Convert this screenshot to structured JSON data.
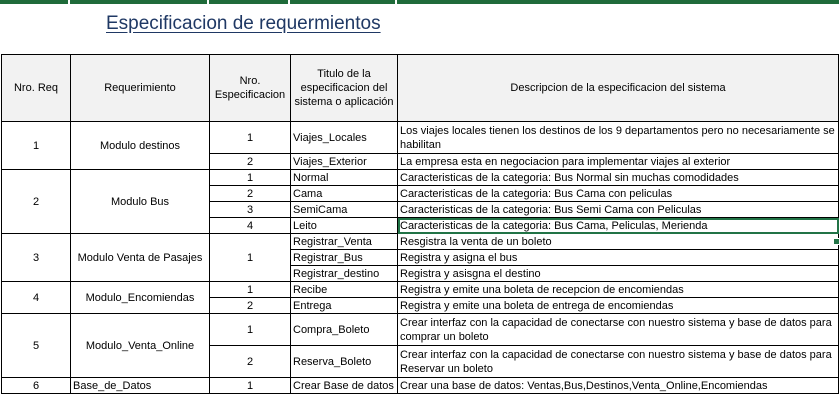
{
  "title": "Especificacion de requermientos",
  "headers": {
    "nro_req": "Nro. Req",
    "requerimiento": "Requerimiento",
    "nro_espec": "Nro. Especificacion",
    "titulo": "Titulo de la especificacion del sistema o aplicación",
    "descripcion": "Descripcion de la especificacion del sistema"
  },
  "requirements": [
    {
      "nro": "1",
      "name": "Modulo destinos",
      "specs": [
        {
          "n": "1",
          "title": "Viajes_Locales",
          "desc": "Los viajes locales tienen los destinos de los 9 departamentos pero no necesariamente se habilitan"
        },
        {
          "n": "2",
          "title": "Viajes_Exterior",
          "desc": "La empresa esta en negociacion para implementar viajes al exterior"
        }
      ]
    },
    {
      "nro": "2",
      "name": "Modulo Bus",
      "specs": [
        {
          "n": "1",
          "title": "Normal",
          "desc": "Caracteristicas de la categoria: Bus Normal sin muchas comodidades"
        },
        {
          "n": "2",
          "title": "Cama",
          "desc": "Caracteristicas de la categoria:  Bus Cama con peliculas"
        },
        {
          "n": "3",
          "title": "SemiCama",
          "desc": "Caracteristicas de la categoria:  Bus Semi Cama con Peliculas"
        },
        {
          "n": "4",
          "title": "Leito",
          "desc": "Caracteristicas de la categoria:  Bus Cama, Peliculas, Merienda"
        }
      ]
    },
    {
      "nro": "3",
      "name": "Modulo Venta de Pasajes",
      "spec_number": "1",
      "titles": [
        {
          "title": "Registrar_Venta",
          "desc": "Resgistra la venta de un boleto"
        },
        {
          "title": "Registrar_Bus",
          "desc": "Registra y asigna el bus"
        },
        {
          "title": "Registrar_destino",
          "desc": "Registra y asisgna el destino"
        }
      ]
    },
    {
      "nro": "4",
      "name": "Modulo_Encomiendas",
      "specs": [
        {
          "n": "1",
          "title": "Recibe",
          "desc": "Registra y emite una boleta de recepcion de encomiendas"
        },
        {
          "n": "2",
          "title": "Entrega",
          "desc": "Registra y emite una boleta de entrega de encomiendas"
        }
      ]
    },
    {
      "nro": "5",
      "name": "Modulo_Venta_Online",
      "specs": [
        {
          "n": "1",
          "title": "Compra_Boleto",
          "desc": "Crear interfaz con la capacidad de conectarse con nuestro sistema y base de datos para comprar un boleto"
        },
        {
          "n": "2",
          "title": "Reserva_Boleto",
          "desc": "Crear interfaz con la capacidad de conectarse con nuestro sistema y base de datos para Reservar un boleto"
        }
      ]
    },
    {
      "nro": "6",
      "name": "Base_de_Datos",
      "specs": [
        {
          "n": "1",
          "title": "Crear Base de datos",
          "desc": "Crear una base de datos: Ventas,Bus,Destinos,Venta_Online,Encomiendas"
        }
      ]
    }
  ]
}
